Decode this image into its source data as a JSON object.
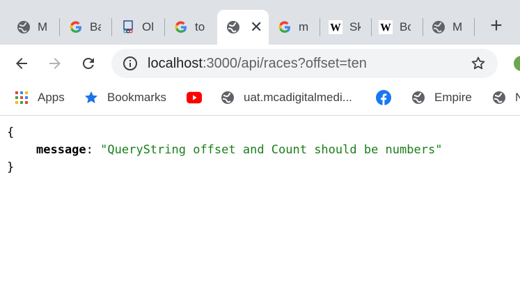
{
  "tabs": [
    {
      "favicon": "globe-icon",
      "title": "M"
    },
    {
      "favicon": "google-icon",
      "title": "Ba"
    },
    {
      "favicon": "olympics-icon",
      "title": "Ol"
    },
    {
      "favicon": "google-icon",
      "title": "to"
    },
    {
      "favicon": "globe-icon",
      "title": "",
      "active": true
    },
    {
      "favicon": "google-icon",
      "title": "m"
    },
    {
      "favicon": "wikipedia-icon",
      "title": "Sk"
    },
    {
      "favicon": "wikipedia-icon",
      "title": "Bc"
    },
    {
      "favicon": "globe-icon",
      "title": "M"
    }
  ],
  "new_tab_label": "+",
  "close_tab_label": "✕",
  "address": {
    "host": "localhost",
    "path": ":3000/api/races?offset=ten"
  },
  "bookmarks": [
    {
      "icon": "apps-grid-icon",
      "label": "Apps"
    },
    {
      "icon": "star-icon",
      "label": "Bookmarks"
    },
    {
      "icon": "youtube-icon",
      "label": ""
    },
    {
      "icon": "globe-icon",
      "label": "uat.mcadigitalmedi..."
    },
    {
      "icon": "facebook-icon",
      "label": ""
    },
    {
      "icon": "globe-icon",
      "label": "Empire"
    },
    {
      "icon": "globe-icon",
      "label": "N"
    }
  ],
  "response": {
    "open_brace": "{",
    "key": "message",
    "colon": ":",
    "value": "\"QueryString offset and Count should be numbers\"",
    "close_brace": "}"
  },
  "colors": {
    "tabstrip": "#dee1e6",
    "omnibox": "#f1f3f4",
    "json_string": "#1a7f1a"
  }
}
